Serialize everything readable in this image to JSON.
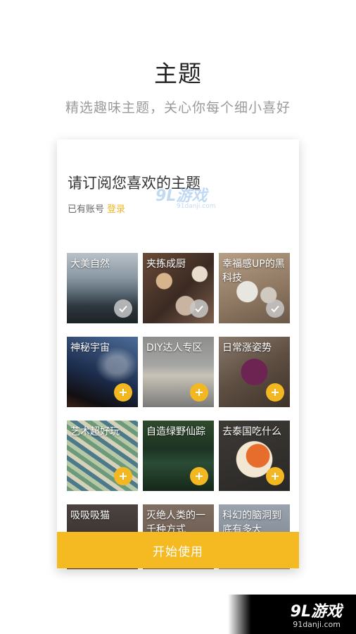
{
  "header": {
    "title": "主题",
    "subtitle": "精选趣味主题，关心你每个细小喜好"
  },
  "card": {
    "title": "请订阅您喜欢的主题",
    "account_text": "已有账号",
    "login_label": "登录"
  },
  "topics": [
    {
      "label": "大美自然",
      "state": "checked",
      "icon": "check-icon"
    },
    {
      "label": "夹拣成厨",
      "state": "checked",
      "icon": "check-icon"
    },
    {
      "label": "幸福感UP的黑科技",
      "state": "checked",
      "icon": "check-icon"
    },
    {
      "label": "神秘宇宙",
      "state": "add",
      "icon": "plus-icon"
    },
    {
      "label": "DIY达人专区",
      "state": "add",
      "icon": "plus-icon"
    },
    {
      "label": "日常涨姿势",
      "state": "add",
      "icon": "plus-icon"
    },
    {
      "label": "艺术超好玩",
      "state": "add",
      "icon": "plus-icon"
    },
    {
      "label": "自造绿野仙踪",
      "state": "add",
      "icon": "plus-icon"
    },
    {
      "label": "去泰国吃什么",
      "state": "add",
      "icon": "plus-icon"
    },
    {
      "label": "吸吸吸猫",
      "state": "add",
      "icon": "plus-icon"
    },
    {
      "label": "灭绝人类的一千种方式",
      "state": "add",
      "icon": "plus-icon"
    },
    {
      "label": "科幻的脑洞到底有多大",
      "state": "add",
      "icon": "plus-icon"
    }
  ],
  "start_button": {
    "label": "开始使用"
  },
  "watermark": {
    "logo": "9L游戏",
    "url": "91danji.com",
    "mid_logo": "9L游戏",
    "mid_url": "91danji.com"
  },
  "colors": {
    "accent": "#f5b922",
    "login_link": "#f0b62a",
    "subtitle_gray": "#9a9a9a"
  }
}
